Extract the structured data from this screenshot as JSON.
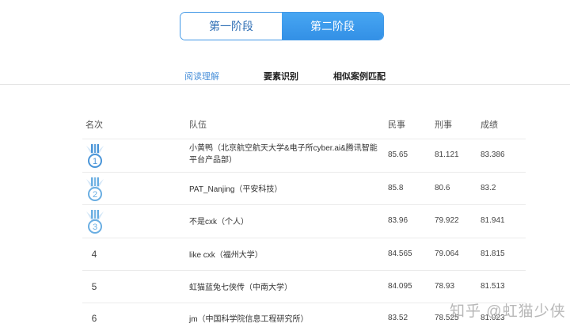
{
  "stages": {
    "stage1": "第一阶段",
    "stage2": "第二阶段"
  },
  "subtabs": {
    "reading": "阅读理解",
    "elements": "要素识别",
    "cases": "相似案例匹配"
  },
  "headers": {
    "rank": "名次",
    "team": "队伍",
    "civil": "民事",
    "criminal": "刑事",
    "score": "成绩"
  },
  "rows": [
    {
      "rank": "1",
      "team": "小黄鸭（北京航空航天大学&电子所cyber.ai&腾讯智能平台产品部）",
      "civil": "85.65",
      "criminal": "81.121",
      "score": "83.386"
    },
    {
      "rank": "2",
      "team": "PAT_Nanjing（平安科技）",
      "civil": "85.8",
      "criminal": "80.6",
      "score": "83.2"
    },
    {
      "rank": "3",
      "team": "不是cxk（个人）",
      "civil": "83.96",
      "criminal": "79.922",
      "score": "81.941"
    },
    {
      "rank": "4",
      "team": "like cxk（福州大学）",
      "civil": "84.565",
      "criminal": "79.064",
      "score": "81.815"
    },
    {
      "rank": "5",
      "team": "虹猫蓝兔七侠传（中南大学）",
      "civil": "84.095",
      "criminal": "78.93",
      "score": "81.513"
    },
    {
      "rank": "6",
      "team": "jm（中国科学院信息工程研究所）",
      "civil": "83.52",
      "criminal": "78.525",
      "score": "81.023"
    }
  ],
  "watermark": "知乎 @虹猫少侠"
}
